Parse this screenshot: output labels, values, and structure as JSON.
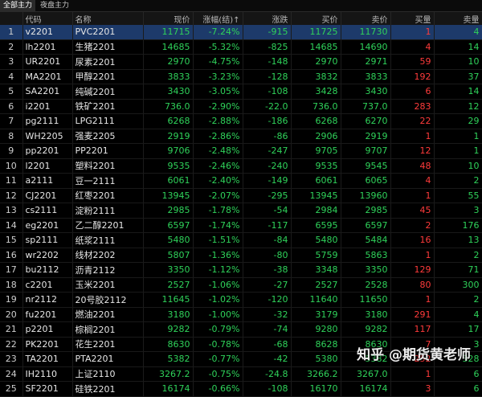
{
  "tabs": [
    {
      "label": "全部主力",
      "active": true
    },
    {
      "label": "夜盘主力",
      "active": false
    }
  ],
  "columns": [
    "",
    "代码",
    "名称",
    "现价",
    "涨幅(结)↑",
    "涨跌",
    "买价",
    "卖价",
    "买量",
    "卖量"
  ],
  "colors": {
    "up": "#ff3b3b",
    "down": "#2fd25a",
    "selected": "#1d3a6a"
  },
  "rows": [
    {
      "idx": "1",
      "code": "v2201",
      "name": "PVC2201",
      "price": "11715",
      "pct": "-7.24%",
      "chg": "-915",
      "bid": "11725",
      "ask": "11730",
      "bidvol": "1",
      "askvol": "4",
      "selected": true
    },
    {
      "idx": "2",
      "code": "lh2201",
      "name": "生猪2201",
      "price": "14685",
      "pct": "-5.32%",
      "chg": "-825",
      "bid": "14685",
      "ask": "14690",
      "bidvol": "4",
      "askvol": "14"
    },
    {
      "idx": "3",
      "code": "UR2201",
      "name": "尿素2201",
      "price": "2970",
      "pct": "-4.75%",
      "chg": "-148",
      "bid": "2970",
      "ask": "2971",
      "bidvol": "59",
      "askvol": "10"
    },
    {
      "idx": "4",
      "code": "MA2201",
      "name": "甲醇2201",
      "price": "3833",
      "pct": "-3.23%",
      "chg": "-128",
      "bid": "3832",
      "ask": "3833",
      "bidvol": "192",
      "askvol": "37"
    },
    {
      "idx": "5",
      "code": "SA2201",
      "name": "纯碱2201",
      "price": "3430",
      "pct": "-3.05%",
      "chg": "-108",
      "bid": "3428",
      "ask": "3430",
      "bidvol": "6",
      "askvol": "14"
    },
    {
      "idx": "6",
      "code": "i2201",
      "name": "铁矿2201",
      "price": "736.0",
      "pct": "-2.90%",
      "chg": "-22.0",
      "bid": "736.0",
      "ask": "737.0",
      "bidvol": "283",
      "askvol": "12"
    },
    {
      "idx": "7",
      "code": "pg2111",
      "name": "LPG2111",
      "price": "6268",
      "pct": "-2.88%",
      "chg": "-186",
      "bid": "6268",
      "ask": "6270",
      "bidvol": "22",
      "askvol": "29"
    },
    {
      "idx": "8",
      "code": "WH2205",
      "name": "强麦2205",
      "price": "2919",
      "pct": "-2.86%",
      "chg": "-86",
      "bid": "2906",
      "ask": "2919",
      "bidvol": "1",
      "askvol": "1"
    },
    {
      "idx": "9",
      "code": "pp2201",
      "name": "PP2201",
      "price": "9706",
      "pct": "-2.48%",
      "chg": "-247",
      "bid": "9705",
      "ask": "9707",
      "bidvol": "12",
      "askvol": "1"
    },
    {
      "idx": "10",
      "code": "l2201",
      "name": "塑料2201",
      "price": "9535",
      "pct": "-2.46%",
      "chg": "-240",
      "bid": "9535",
      "ask": "9545",
      "bidvol": "48",
      "askvol": "10"
    },
    {
      "idx": "11",
      "code": "a2111",
      "name": "豆一2111",
      "price": "6061",
      "pct": "-2.40%",
      "chg": "-149",
      "bid": "6061",
      "ask": "6065",
      "bidvol": "4",
      "askvol": "2"
    },
    {
      "idx": "12",
      "code": "CJ2201",
      "name": "红枣2201",
      "price": "13945",
      "pct": "-2.07%",
      "chg": "-295",
      "bid": "13945",
      "ask": "13960",
      "bidvol": "1",
      "askvol": "55"
    },
    {
      "idx": "13",
      "code": "cs2111",
      "name": "淀粉2111",
      "price": "2985",
      "pct": "-1.78%",
      "chg": "-54",
      "bid": "2984",
      "ask": "2985",
      "bidvol": "45",
      "askvol": "3"
    },
    {
      "idx": "14",
      "code": "eg2201",
      "name": "乙二醇2201",
      "price": "6597",
      "pct": "-1.74%",
      "chg": "-117",
      "bid": "6595",
      "ask": "6597",
      "bidvol": "2",
      "askvol": "176"
    },
    {
      "idx": "15",
      "code": "sp2111",
      "name": "纸浆2111",
      "price": "5480",
      "pct": "-1.51%",
      "chg": "-84",
      "bid": "5480",
      "ask": "5484",
      "bidvol": "16",
      "askvol": "13"
    },
    {
      "idx": "16",
      "code": "wr2202",
      "name": "线材2202",
      "price": "5807",
      "pct": "-1.36%",
      "chg": "-80",
      "bid": "5759",
      "ask": "5863",
      "bidvol": "1",
      "askvol": "2"
    },
    {
      "idx": "17",
      "code": "bu2112",
      "name": "沥青2112",
      "price": "3350",
      "pct": "-1.12%",
      "chg": "-38",
      "bid": "3348",
      "ask": "3350",
      "bidvol": "129",
      "askvol": "71"
    },
    {
      "idx": "18",
      "code": "c2201",
      "name": "玉米2201",
      "price": "2527",
      "pct": "-1.06%",
      "chg": "-27",
      "bid": "2527",
      "ask": "2528",
      "bidvol": "80",
      "askvol": "300"
    },
    {
      "idx": "19",
      "code": "nr2112",
      "name": "20号胶2112",
      "price": "11645",
      "pct": "-1.02%",
      "chg": "-120",
      "bid": "11640",
      "ask": "11650",
      "bidvol": "1",
      "askvol": "2"
    },
    {
      "idx": "20",
      "code": "fu2201",
      "name": "燃油2201",
      "price": "3180",
      "pct": "-1.00%",
      "chg": "-32",
      "bid": "3179",
      "ask": "3180",
      "bidvol": "291",
      "askvol": "4"
    },
    {
      "idx": "21",
      "code": "p2201",
      "name": "棕榈2201",
      "price": "9282",
      "pct": "-0.79%",
      "chg": "-74",
      "bid": "9280",
      "ask": "9282",
      "bidvol": "117",
      "askvol": "17"
    },
    {
      "idx": "22",
      "code": "PK2201",
      "name": "花生2201",
      "price": "8630",
      "pct": "-0.78%",
      "chg": "-68",
      "bid": "8628",
      "ask": "8630",
      "bidvol": "7",
      "askvol": "3"
    },
    {
      "idx": "23",
      "code": "TA2201",
      "name": "PTA2201",
      "price": "5382",
      "pct": "-0.77%",
      "chg": "-42",
      "bid": "5380",
      "ask": "5382",
      "bidvol": "252",
      "askvol": "328"
    },
    {
      "idx": "24",
      "code": "IH2110",
      "name": "上证2110",
      "price": "3267.2",
      "pct": "-0.75%",
      "chg": "-24.8",
      "bid": "3266.2",
      "ask": "3267.0",
      "bidvol": "1",
      "askvol": "6"
    },
    {
      "idx": "25",
      "code": "SF2201",
      "name": "硅铁2201",
      "price": "16174",
      "pct": "-0.66%",
      "chg": "-108",
      "bid": "16170",
      "ask": "16174",
      "bidvol": "3",
      "askvol": "6"
    }
  ],
  "watermark": {
    "text": "知乎 @期货黄老师"
  }
}
